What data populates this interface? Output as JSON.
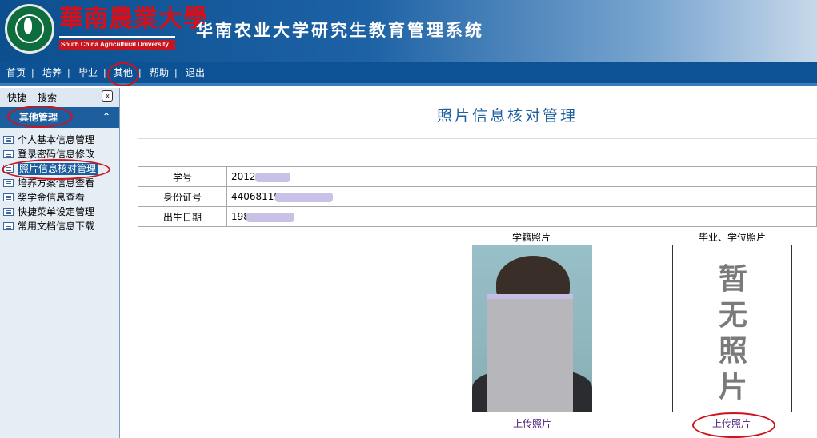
{
  "header": {
    "logo_cn": "華南農業大學",
    "logo_en": "South China Agricultural University",
    "system_title": "华南农业大学研究生教育管理系统"
  },
  "topnav": {
    "items": [
      "首页",
      "培养",
      "毕业",
      "其他",
      "帮助",
      "退出"
    ],
    "separator": "|",
    "active": "其他"
  },
  "sidebar": {
    "tabs": [
      "快捷",
      "搜索"
    ],
    "collapse_glyph": "«",
    "section_label": "其他管理",
    "section_glyph": "⌃",
    "items": [
      "个人基本信息管理",
      "登录密码信息修改",
      "照片信息核对管理",
      "培养方案信息查看",
      "奖学金信息查看",
      "快捷菜单设定管理",
      "常用文档信息下载"
    ],
    "active_item": "照片信息核对管理"
  },
  "main": {
    "page_title": "照片信息核对管理",
    "info_rows": [
      {
        "label": "学号",
        "value": "20122"
      },
      {
        "label": "身份证号",
        "value": "44068119"
      },
      {
        "label": "出生日期",
        "value": "198"
      }
    ],
    "photo_enrollment": {
      "caption": "学籍照片",
      "upload_label": "上传照片"
    },
    "photo_degree": {
      "caption": "毕业、学位照片",
      "placeholder": "暂无照片",
      "upload_label": "上传照片"
    }
  },
  "colors": {
    "header_blue": "#0b4f8f",
    "nav_blue": "#0d5295",
    "section_blue": "#1d5e9f",
    "annotation_red": "#d0121b",
    "title_blue": "#1e5f9f",
    "link_purple": "#4b1a78"
  }
}
